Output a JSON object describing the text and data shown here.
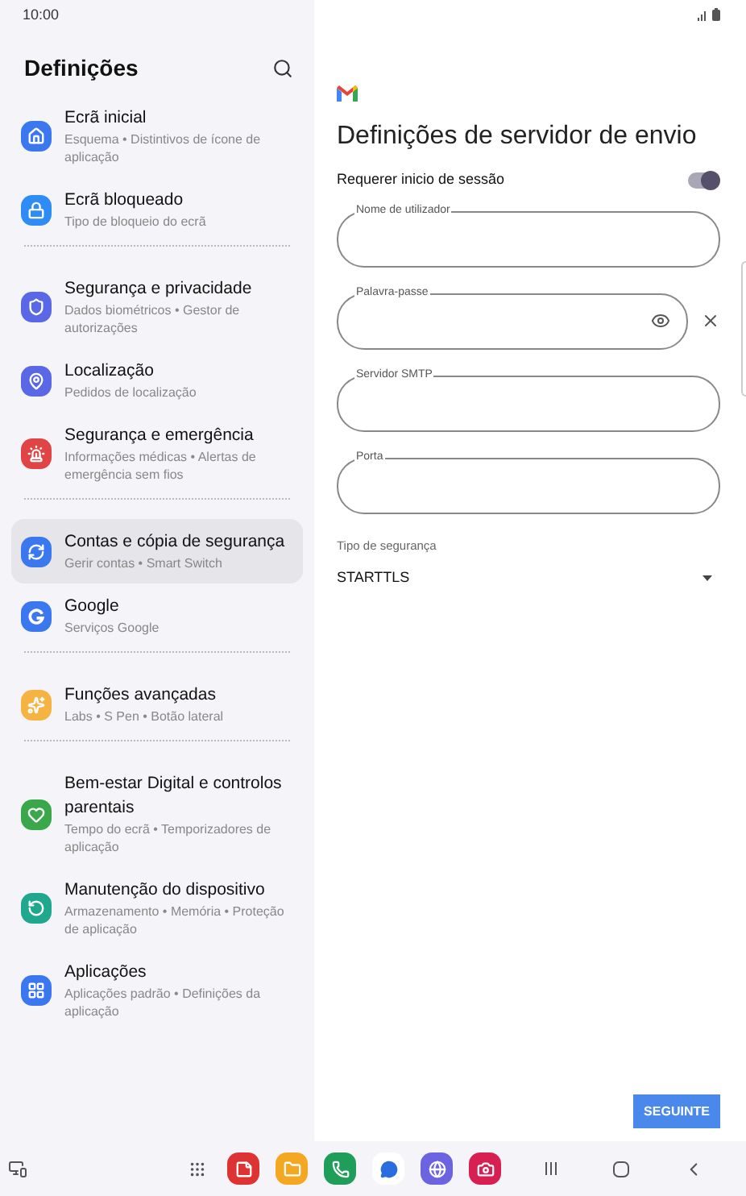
{
  "status_bar": {
    "time": "10:00"
  },
  "sidebar": {
    "title": "Definições",
    "groups": [
      [
        {
          "kind": "home",
          "title": "Ecrã inicial",
          "subtitle": "Esquema • Distintivos de ícone de aplicação",
          "selected": false
        },
        {
          "kind": "lock",
          "title": "Ecrã bloqueado",
          "subtitle": "Tipo de bloqueio do ecrã",
          "selected": false
        }
      ],
      [
        {
          "kind": "shield",
          "title": "Segurança e privacidade",
          "subtitle": "Dados biométricos • Gestor de autorizações",
          "selected": false
        },
        {
          "kind": "pin",
          "title": "Localização",
          "subtitle": "Pedidos de localização",
          "selected": false
        },
        {
          "kind": "alert",
          "title": "Segurança e emergência",
          "subtitle": "Informações médicas • Alertas de emergência sem fios",
          "selected": false
        }
      ],
      [
        {
          "kind": "sync",
          "title": "Contas e cópia de segurança",
          "subtitle": "Gerir contas • Smart Switch",
          "selected": true
        },
        {
          "kind": "google",
          "title": "Google",
          "subtitle": "Serviços Google",
          "selected": false
        }
      ],
      [
        {
          "kind": "star",
          "title": "Funções avançadas",
          "subtitle": "Labs • S Pen • Botão lateral",
          "selected": false
        }
      ],
      [
        {
          "kind": "wellbeing",
          "title": "Bem-estar Digital e controlos parentais",
          "subtitle": "Tempo do ecrã • Temporizadores de aplicação",
          "selected": false
        },
        {
          "kind": "care",
          "title": "Manutenção do dispositivo",
          "subtitle": "Armazenamento • Memória • Proteção de aplicação",
          "selected": false
        },
        {
          "kind": "apps",
          "title": "Aplicações",
          "subtitle": "Aplicações padrão • Definições da aplicação",
          "selected": false
        }
      ]
    ]
  },
  "form": {
    "title": "Definições de servidor de envio",
    "toggle": {
      "label": "Requerer inicio de sessão",
      "on": true
    },
    "fields": [
      {
        "label": "Nome de utilizador",
        "kind": "text"
      },
      {
        "label": "Palavra-passe",
        "kind": "password"
      },
      {
        "label": "Servidor SMTP",
        "kind": "text"
      },
      {
        "label": "Porta",
        "kind": "text"
      }
    ],
    "security": {
      "label": "Tipo de segurança",
      "value": "STARTTLS"
    },
    "button": "SEGUINTE"
  }
}
